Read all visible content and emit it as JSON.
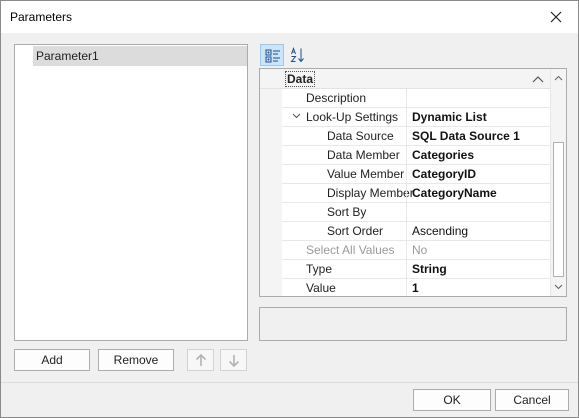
{
  "window": {
    "title": "Parameters"
  },
  "parameters": {
    "items": [
      "Parameter1"
    ]
  },
  "list_buttons": {
    "add": "Add",
    "remove": "Remove"
  },
  "property_grid": {
    "category": "Data",
    "rows": [
      {
        "name": "Description",
        "value": "",
        "indent": 1,
        "bold": false,
        "disabled": false
      },
      {
        "name": "Look-Up Settings",
        "value": "Dynamic List",
        "indent": 1,
        "bold": true,
        "disabled": false,
        "expanded": true
      },
      {
        "name": "Data Source",
        "value": "SQL Data Source 1",
        "indent": 2,
        "bold": true,
        "disabled": false
      },
      {
        "name": "Data Member",
        "value": "Categories",
        "indent": 2,
        "bold": true,
        "disabled": false
      },
      {
        "name": "Value Member",
        "value": "CategoryID",
        "indent": 2,
        "bold": true,
        "disabled": false
      },
      {
        "name": "Display Member",
        "value": "CategoryName",
        "indent": 2,
        "bold": true,
        "disabled": false
      },
      {
        "name": "Sort By",
        "value": "",
        "indent": 2,
        "bold": false,
        "disabled": false
      },
      {
        "name": "Sort Order",
        "value": "Ascending",
        "indent": 2,
        "bold": false,
        "disabled": false
      },
      {
        "name": "Select All Values",
        "value": "No",
        "indent": 1,
        "bold": false,
        "disabled": true
      },
      {
        "name": "Type",
        "value": "String",
        "indent": 1,
        "bold": true,
        "disabled": false
      },
      {
        "name": "Value",
        "value": "1",
        "indent": 1,
        "bold": true,
        "disabled": false
      }
    ]
  },
  "footer": {
    "ok": "OK",
    "cancel": "Cancel"
  },
  "icons": {
    "close": "close-icon",
    "move_up": "arrow-up-icon",
    "move_down": "arrow-down-icon",
    "categorized": "categorized-view-icon",
    "alphabetical": "sort-alphabetical-icon",
    "collapse": "chevron-up-icon",
    "expand": "chevron-down-icon"
  }
}
